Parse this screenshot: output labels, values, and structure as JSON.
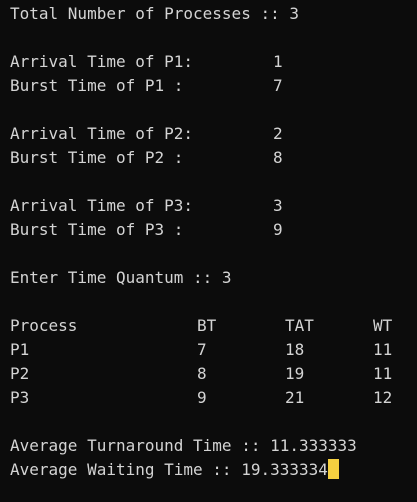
{
  "terminal": {
    "total_processes": "Total Number of Processes :: 3",
    "inputs": [
      {
        "arrival_label": "Arrival Time of P1:",
        "arrival_value": "1",
        "burst_label": "Burst Time of P1 :",
        "burst_value": "7"
      },
      {
        "arrival_label": "Arrival Time of P2:",
        "arrival_value": "2",
        "burst_label": "Burst Time of P2 :",
        "burst_value": "8"
      },
      {
        "arrival_label": "Arrival Time of P3:",
        "arrival_value": "3",
        "burst_label": "Burst Time of P3 :",
        "burst_value": "9"
      }
    ],
    "time_quantum": "Enter Time Quantum :: 3",
    "table": {
      "headers": [
        "Process",
        "BT",
        "TAT",
        "WT"
      ],
      "rows": [
        [
          "P1",
          "7",
          "18",
          "11"
        ],
        [
          "P2",
          "8",
          "19",
          "11"
        ],
        [
          "P3",
          "9",
          "21",
          "12"
        ]
      ]
    },
    "avg_turnaround": "Average Turnaround Time :: 11.333333",
    "avg_waiting": "Average Waiting Time :: 19.333334",
    "cursor_color": "#f5d040"
  }
}
